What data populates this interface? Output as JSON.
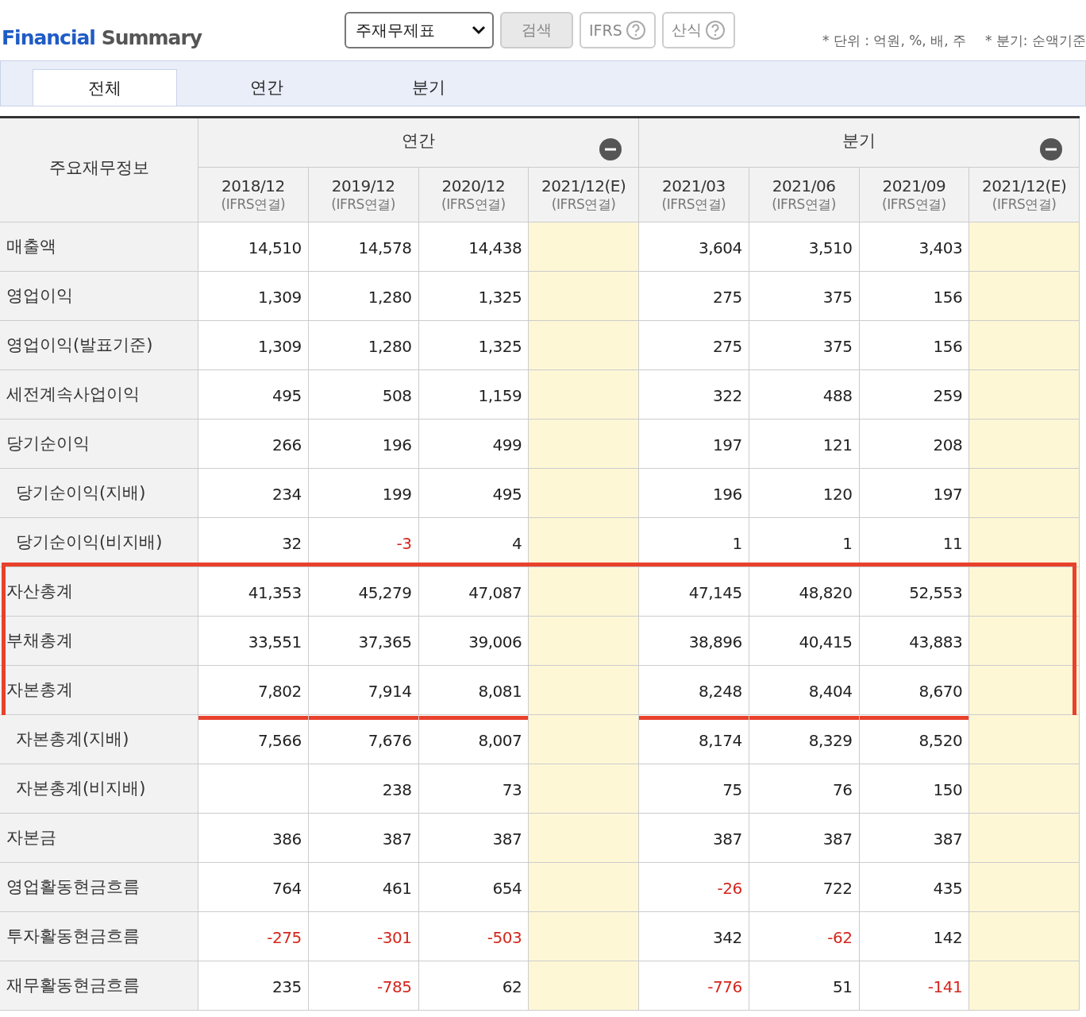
{
  "header": {
    "title_accent": "Financial",
    "title": "Summary",
    "select": {
      "value": "주재무제표"
    },
    "buttons": [
      {
        "label": "검색",
        "kind": "plain"
      },
      {
        "label": "IFRS",
        "kind": "help"
      },
      {
        "label": "산식",
        "kind": "help"
      }
    ],
    "notes": [
      "* 단위 : 억원, %, 배, 주",
      "* 분기: 순액기준"
    ]
  },
  "tabs": [
    {
      "label": "전체",
      "selected": true
    },
    {
      "label": "연간",
      "selected": false
    },
    {
      "label": "분기",
      "selected": false
    }
  ],
  "table": {
    "corner": "주요재무정보",
    "groups": [
      {
        "label": "연간"
      },
      {
        "label": "분기"
      }
    ],
    "columns": [
      {
        "period": "2018/12",
        "basis": "(IFRS연결)",
        "estimate": false
      },
      {
        "period": "2019/12",
        "basis": "(IFRS연결)",
        "estimate": false
      },
      {
        "period": "2020/12",
        "basis": "(IFRS연결)",
        "estimate": false
      },
      {
        "period": "2021/12(E)",
        "basis": "(IFRS연결)",
        "estimate": true
      },
      {
        "period": "2021/03",
        "basis": "(IFRS연결)",
        "estimate": false
      },
      {
        "period": "2021/06",
        "basis": "(IFRS연결)",
        "estimate": false
      },
      {
        "period": "2021/09",
        "basis": "(IFRS연결)",
        "estimate": false
      },
      {
        "period": "2021/12(E)",
        "basis": "(IFRS연결)",
        "estimate": true
      }
    ],
    "rows": [
      {
        "label": "매출액",
        "highlighted": false,
        "cells": [
          {
            "text": "14,510",
            "negative": false
          },
          {
            "text": "14,578",
            "negative": false
          },
          {
            "text": "14,438",
            "negative": false
          },
          null,
          {
            "text": "3,604",
            "negative": false
          },
          {
            "text": "3,510",
            "negative": false
          },
          {
            "text": "3,403",
            "negative": false
          },
          null
        ]
      },
      {
        "label": "영업이익",
        "highlighted": false,
        "cells": [
          {
            "text": "1,309",
            "negative": false
          },
          {
            "text": "1,280",
            "negative": false
          },
          {
            "text": "1,325",
            "negative": false
          },
          null,
          {
            "text": "275",
            "negative": false
          },
          {
            "text": "375",
            "negative": false
          },
          {
            "text": "156",
            "negative": false
          },
          null
        ]
      },
      {
        "label": "영업이익(발표기준)",
        "highlighted": false,
        "cells": [
          {
            "text": "1,309",
            "negative": false
          },
          {
            "text": "1,280",
            "negative": false
          },
          {
            "text": "1,325",
            "negative": false
          },
          null,
          {
            "text": "275",
            "negative": false
          },
          {
            "text": "375",
            "negative": false
          },
          {
            "text": "156",
            "negative": false
          },
          null
        ]
      },
      {
        "label": "세전계속사업이익",
        "highlighted": false,
        "cells": [
          {
            "text": "495",
            "negative": false
          },
          {
            "text": "508",
            "negative": false
          },
          {
            "text": "1,159",
            "negative": false
          },
          null,
          {
            "text": "322",
            "negative": false
          },
          {
            "text": "488",
            "negative": false
          },
          {
            "text": "259",
            "negative": false
          },
          null
        ]
      },
      {
        "label": "당기순이익",
        "highlighted": false,
        "cells": [
          {
            "text": "266",
            "negative": false
          },
          {
            "text": "196",
            "negative": false
          },
          {
            "text": "499",
            "negative": false
          },
          null,
          {
            "text": "197",
            "negative": false
          },
          {
            "text": "121",
            "negative": false
          },
          {
            "text": "208",
            "negative": false
          },
          null
        ],
        "children": [
          {
            "label": "당기순이익(지배)",
            "highlighted": false,
            "cells": [
              {
                "text": "234",
                "negative": false
              },
              {
                "text": "199",
                "negative": false
              },
              {
                "text": "495",
                "negative": false
              },
              null,
              {
                "text": "196",
                "negative": false
              },
              {
                "text": "120",
                "negative": false
              },
              {
                "text": "197",
                "negative": false
              },
              null
            ]
          },
          {
            "label": "당기순이익(비지배)",
            "highlighted": false,
            "cells": [
              {
                "text": "32",
                "negative": false
              },
              {
                "text": "-3",
                "negative": true
              },
              {
                "text": "4",
                "negative": false
              },
              null,
              {
                "text": "1",
                "negative": false
              },
              {
                "text": "1",
                "negative": false
              },
              {
                "text": "11",
                "negative": false
              },
              null
            ]
          }
        ]
      },
      {
        "label": "자산총계",
        "highlighted": true,
        "cells": [
          {
            "text": "41,353",
            "negative": false
          },
          {
            "text": "45,279",
            "negative": false
          },
          {
            "text": "47,087",
            "negative": false
          },
          null,
          {
            "text": "47,145",
            "negative": false
          },
          {
            "text": "48,820",
            "negative": false
          },
          {
            "text": "52,553",
            "negative": false
          },
          null
        ]
      },
      {
        "label": "부채총계",
        "highlighted": true,
        "cells": [
          {
            "text": "33,551",
            "negative": false
          },
          {
            "text": "37,365",
            "negative": false
          },
          {
            "text": "39,006",
            "negative": false
          },
          null,
          {
            "text": "38,896",
            "negative": false
          },
          {
            "text": "40,415",
            "negative": false
          },
          {
            "text": "43,883",
            "negative": false
          },
          null
        ]
      },
      {
        "label": "자본총계",
        "highlighted": true,
        "cells": [
          {
            "text": "7,802",
            "negative": false
          },
          {
            "text": "7,914",
            "negative": false
          },
          {
            "text": "8,081",
            "negative": false
          },
          null,
          {
            "text": "8,248",
            "negative": false
          },
          {
            "text": "8,404",
            "negative": false
          },
          {
            "text": "8,670",
            "negative": false
          },
          null
        ],
        "children": [
          {
            "label": "자본총계(지배)",
            "highlighted": false,
            "cells": [
              {
                "text": "7,566",
                "negative": false
              },
              {
                "text": "7,676",
                "negative": false
              },
              {
                "text": "8,007",
                "negative": false
              },
              null,
              {
                "text": "8,174",
                "negative": false
              },
              {
                "text": "8,329",
                "negative": false
              },
              {
                "text": "8,520",
                "negative": false
              },
              null
            ]
          },
          {
            "label": "자본총계(비지배)",
            "highlighted": false,
            "cells": [
              null,
              {
                "text": "238",
                "negative": false
              },
              {
                "text": "73",
                "negative": false
              },
              null,
              {
                "text": "75",
                "negative": false
              },
              {
                "text": "76",
                "negative": false
              },
              {
                "text": "150",
                "negative": false
              },
              null
            ]
          }
        ]
      },
      {
        "label": "자본금",
        "highlighted": false,
        "cells": [
          {
            "text": "386",
            "negative": false
          },
          {
            "text": "387",
            "negative": false
          },
          {
            "text": "387",
            "negative": false
          },
          null,
          {
            "text": "387",
            "negative": false
          },
          {
            "text": "387",
            "negative": false
          },
          {
            "text": "387",
            "negative": false
          },
          null
        ]
      },
      {
        "label": "영업활동현금흐름",
        "highlighted": false,
        "cells": [
          {
            "text": "764",
            "negative": false
          },
          {
            "text": "461",
            "negative": false
          },
          {
            "text": "654",
            "negative": false
          },
          null,
          {
            "text": "-26",
            "negative": true
          },
          {
            "text": "722",
            "negative": false
          },
          {
            "text": "435",
            "negative": false
          },
          null
        ]
      },
      {
        "label": "투자활동현금흐름",
        "highlighted": false,
        "cells": [
          {
            "text": "-275",
            "negative": true
          },
          {
            "text": "-301",
            "negative": true
          },
          {
            "text": "-503",
            "negative": true
          },
          null,
          {
            "text": "342",
            "negative": false
          },
          {
            "text": "-62",
            "negative": true
          },
          {
            "text": "142",
            "negative": false
          },
          null
        ]
      },
      {
        "label": "재무활동현금흐름",
        "highlighted": false,
        "cells": [
          {
            "text": "235",
            "negative": false
          },
          {
            "text": "-785",
            "negative": true
          },
          {
            "text": "62",
            "negative": false
          },
          null,
          {
            "text": "-776",
            "negative": true
          },
          {
            "text": "51",
            "negative": false
          },
          {
            "text": "-141",
            "negative": true
          },
          null
        ]
      }
    ]
  }
}
